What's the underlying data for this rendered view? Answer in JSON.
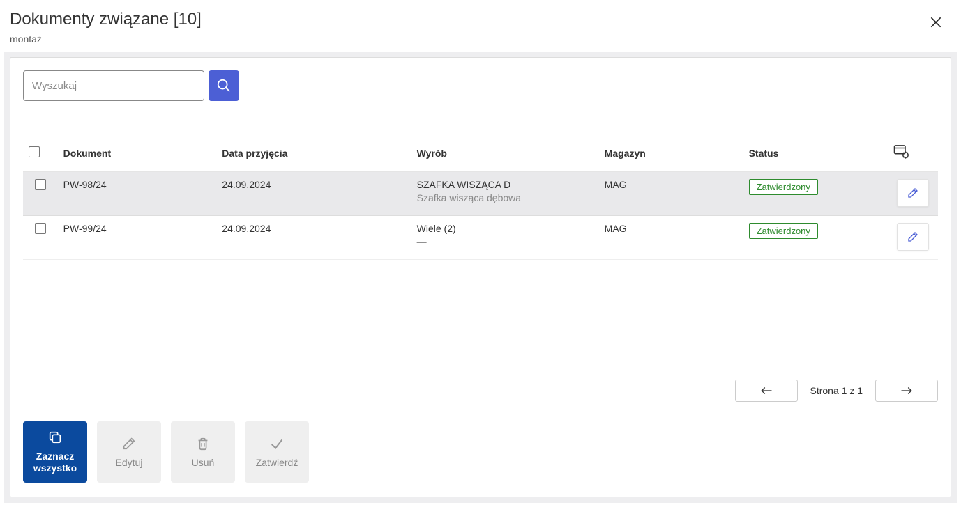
{
  "header": {
    "title": "Dokumenty związane [10]",
    "subtitle": "montaż"
  },
  "search": {
    "placeholder": "Wyszukaj"
  },
  "table": {
    "headers": {
      "document": "Dokument",
      "date": "Data przyjęcia",
      "product": "Wyrób",
      "warehouse": "Magazyn",
      "status": "Status"
    },
    "rows": [
      {
        "document": "PW-98/24",
        "date": "24.09.2024",
        "product": "SZAFKA WISZĄCA D",
        "product_sub": "Szafka wisząca dębowa",
        "warehouse": "MAG",
        "status": "Zatwierdzony"
      },
      {
        "document": "PW-99/24",
        "date": "24.09.2024",
        "product": "Wiele (2)",
        "product_sub": "—",
        "warehouse": "MAG",
        "status": "Zatwierdzony"
      }
    ]
  },
  "pagination": {
    "label": "Strona 1 z 1"
  },
  "toolbar": {
    "select_all": "Zaznacz\nwszystko",
    "edit": "Edytuj",
    "delete": "Usuń",
    "approve": "Zatwierdź"
  }
}
